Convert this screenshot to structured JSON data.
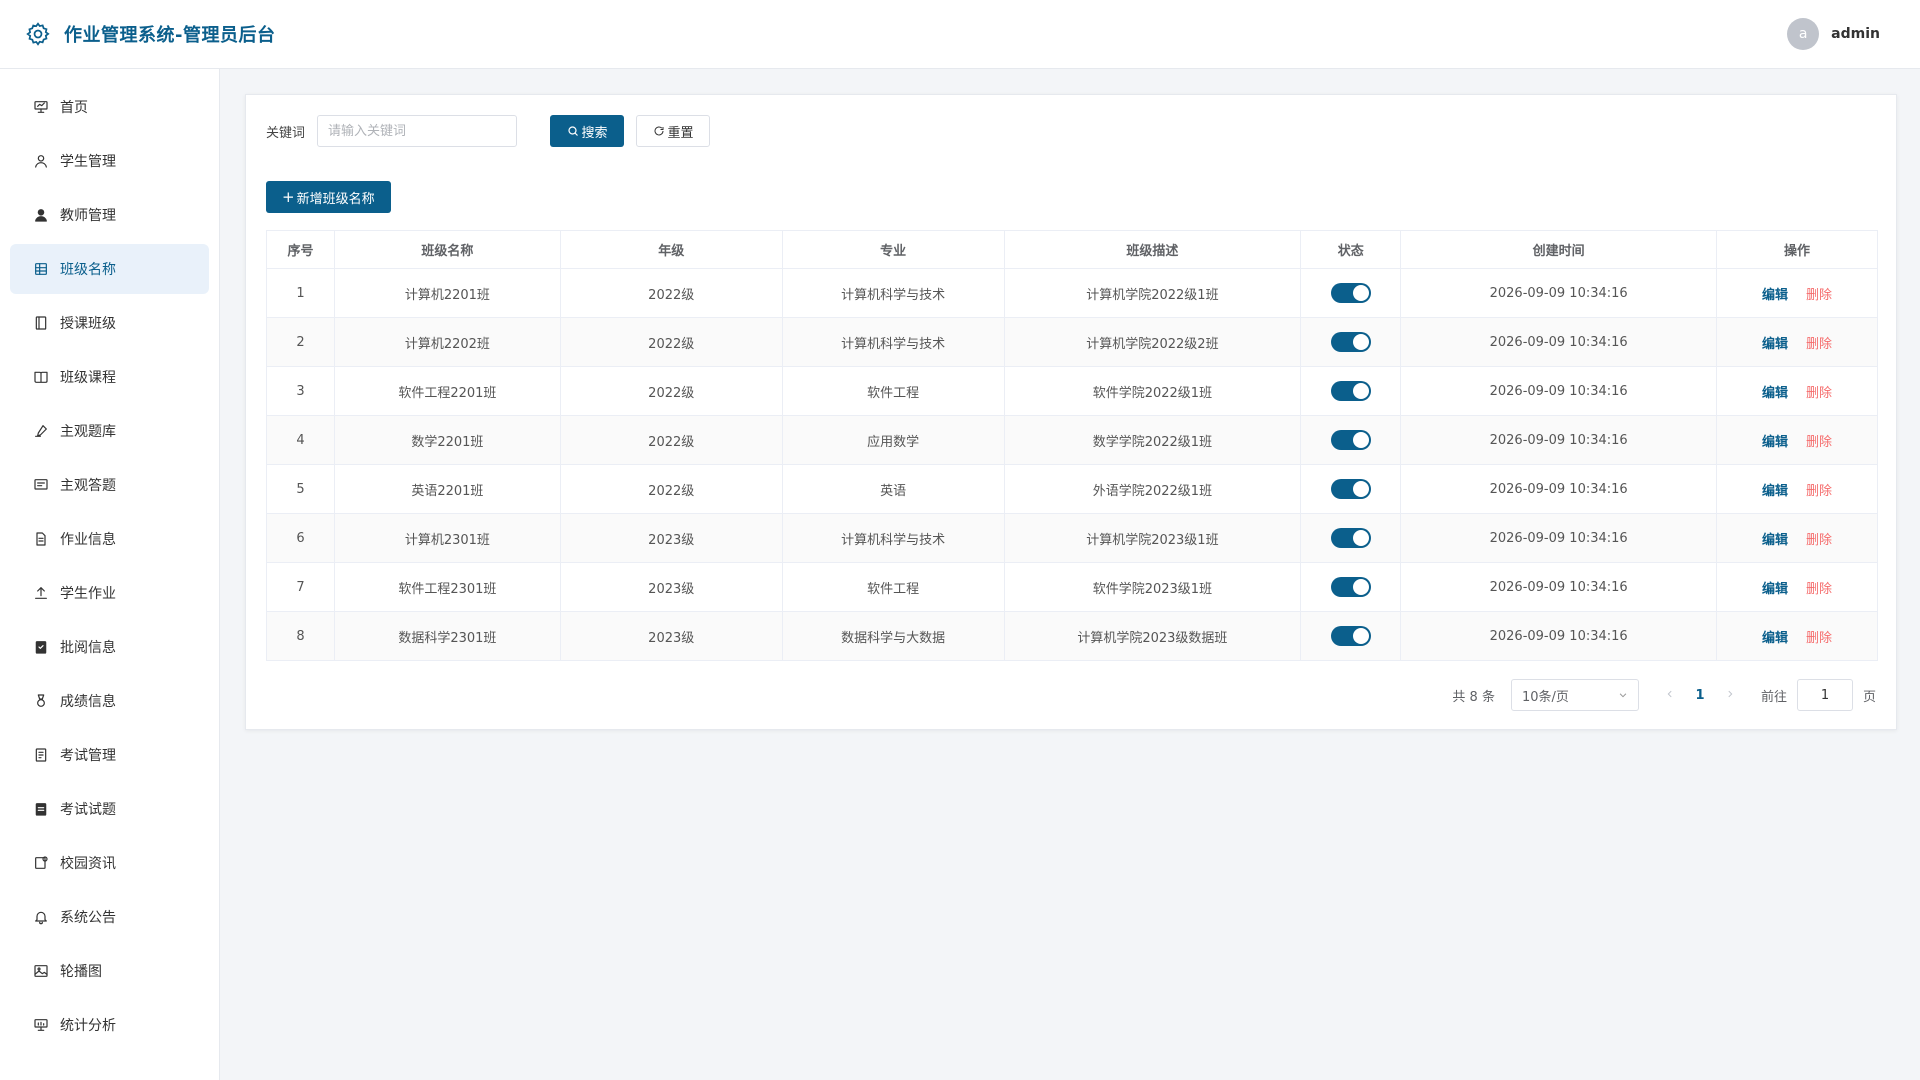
{
  "app": {
    "title": "作业管理系统-管理员后台"
  },
  "user": {
    "avatar_letter": "a",
    "name": "admin"
  },
  "sidebar": {
    "items": [
      {
        "label": "首页",
        "icon": "presentation-icon"
      },
      {
        "label": "学生管理",
        "icon": "user-icon"
      },
      {
        "label": "教师管理",
        "icon": "user-filled-icon"
      },
      {
        "label": "班级名称",
        "icon": "grid-icon",
        "active": true
      },
      {
        "label": "授课班级",
        "icon": "notebook-icon"
      },
      {
        "label": "班级课程",
        "icon": "book-icon"
      },
      {
        "label": "主观题库",
        "icon": "edit-pen-icon"
      },
      {
        "label": "主观答题",
        "icon": "chat-icon"
      },
      {
        "label": "作业信息",
        "icon": "document-icon"
      },
      {
        "label": "学生作业",
        "icon": "upload-icon"
      },
      {
        "label": "批阅信息",
        "icon": "checked-clipboard-icon"
      },
      {
        "label": "成绩信息",
        "icon": "medal-icon"
      },
      {
        "label": "考试管理",
        "icon": "tickets-icon"
      },
      {
        "label": "考试试题",
        "icon": "clipboard-list-icon"
      },
      {
        "label": "校园资讯",
        "icon": "news-icon"
      },
      {
        "label": "系统公告",
        "icon": "bell-icon"
      },
      {
        "label": "轮播图",
        "icon": "picture-icon"
      },
      {
        "label": "统计分析",
        "icon": "chart-board-icon"
      }
    ]
  },
  "search": {
    "label": "关键词",
    "placeholder": "请输入关键词",
    "value": "",
    "search_label": "搜索",
    "reset_label": "重置"
  },
  "add_label": "新增班级名称",
  "table": {
    "columns": [
      "序号",
      "班级名称",
      "年级",
      "专业",
      "班级描述",
      "状态",
      "创建时间",
      "操作"
    ],
    "edit_label": "编辑",
    "delete_label": "删除",
    "rows": [
      {
        "no": "1",
        "name": "计算机2201班",
        "grade": "2022级",
        "major": "计算机科学与技术",
        "desc": "计算机学院2022级1班",
        "status": true,
        "created": "2026-09-09 10:34:16"
      },
      {
        "no": "2",
        "name": "计算机2202班",
        "grade": "2022级",
        "major": "计算机科学与技术",
        "desc": "计算机学院2022级2班",
        "status": true,
        "created": "2026-09-09 10:34:16"
      },
      {
        "no": "3",
        "name": "软件工程2201班",
        "grade": "2022级",
        "major": "软件工程",
        "desc": "软件学院2022级1班",
        "status": true,
        "created": "2026-09-09 10:34:16"
      },
      {
        "no": "4",
        "name": "数学2201班",
        "grade": "2022级",
        "major": "应用数学",
        "desc": "数学学院2022级1班",
        "status": true,
        "created": "2026-09-09 10:34:16"
      },
      {
        "no": "5",
        "name": "英语2201班",
        "grade": "2022级",
        "major": "英语",
        "desc": "外语学院2022级1班",
        "status": true,
        "created": "2026-09-09 10:34:16"
      },
      {
        "no": "6",
        "name": "计算机2301班",
        "grade": "2023级",
        "major": "计算机科学与技术",
        "desc": "计算机学院2023级1班",
        "status": true,
        "created": "2026-09-09 10:34:16"
      },
      {
        "no": "7",
        "name": "软件工程2301班",
        "grade": "2023级",
        "major": "软件工程",
        "desc": "软件学院2023级1班",
        "status": true,
        "created": "2026-09-09 10:34:16"
      },
      {
        "no": "8",
        "name": "数据科学2301班",
        "grade": "2023级",
        "major": "数据科学与大数据",
        "desc": "计算机学院2023级数据班",
        "status": true,
        "created": "2026-09-09 10:34:16"
      }
    ]
  },
  "pagination": {
    "total_text": "共 8 条",
    "page_size": "10条/页",
    "current_page": "1",
    "goto_prefix": "前往",
    "goto_value": "1",
    "goto_suffix": "页"
  },
  "colors": {
    "primary": "#0b5f8c",
    "danger": "#f56c6c",
    "active_bg": "#e9f1fa"
  }
}
